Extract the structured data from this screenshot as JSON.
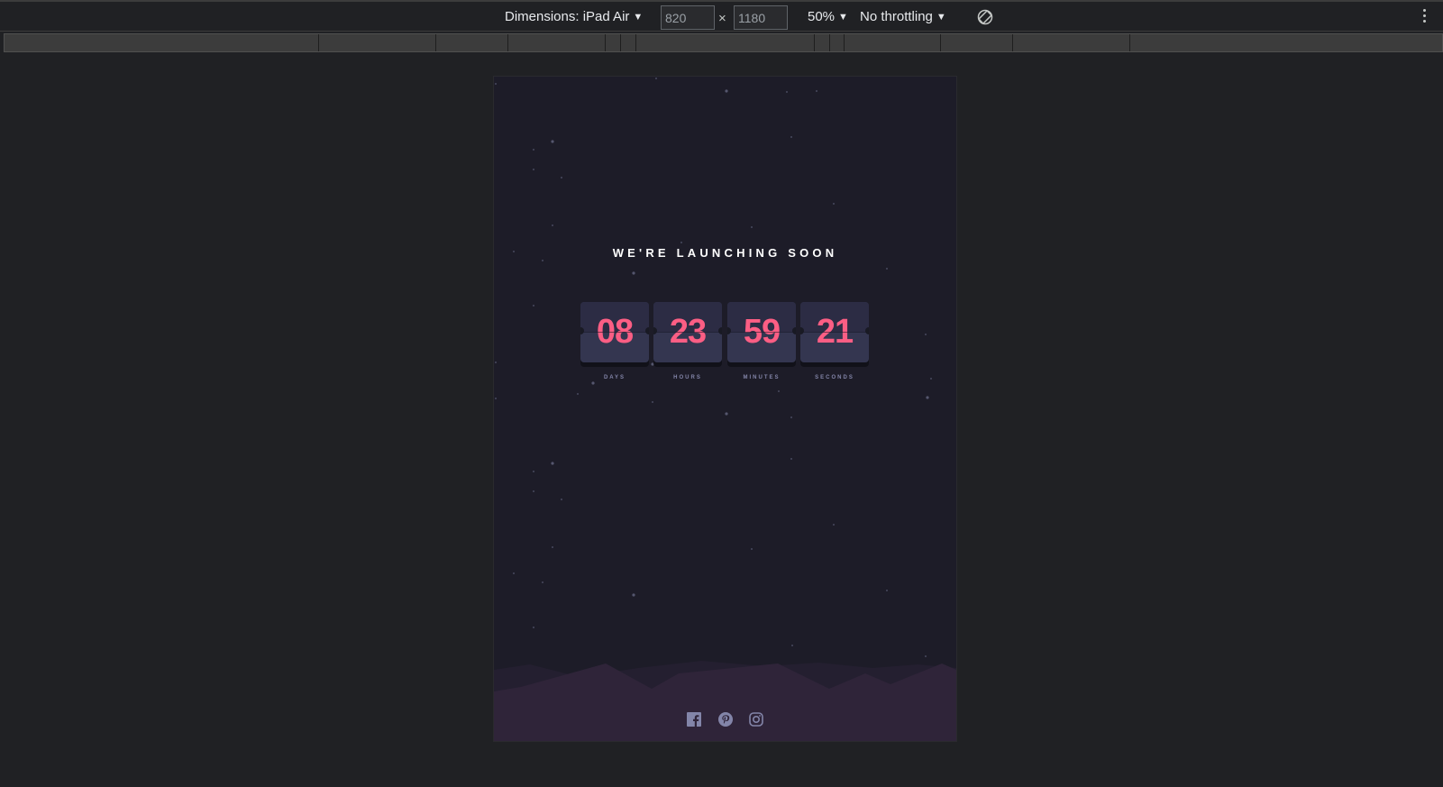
{
  "toolbar": {
    "device_label": "Dimensions: iPad Air",
    "width_value": "820",
    "height_value": "1180",
    "times_symbol": "×",
    "zoom_label": "50%",
    "throttle_label": "No throttling",
    "caret": "▼"
  },
  "page": {
    "headline": "WE'RE LAUNCHING SOON",
    "countdown": [
      {
        "value": "08",
        "label": "DAYS"
      },
      {
        "value": "23",
        "label": "HOURS"
      },
      {
        "value": "59",
        "label": "MINUTES"
      },
      {
        "value": "21",
        "label": "SECONDS"
      }
    ],
    "socials": [
      "facebook-icon",
      "pinterest-icon",
      "instagram-icon"
    ]
  },
  "colors": {
    "page_background": "#202124",
    "viewport_background": "#1d1c28",
    "card_face": "#343650",
    "digit": "#fb5e84",
    "label": "#8385a9",
    "hills": "#2f2439"
  }
}
